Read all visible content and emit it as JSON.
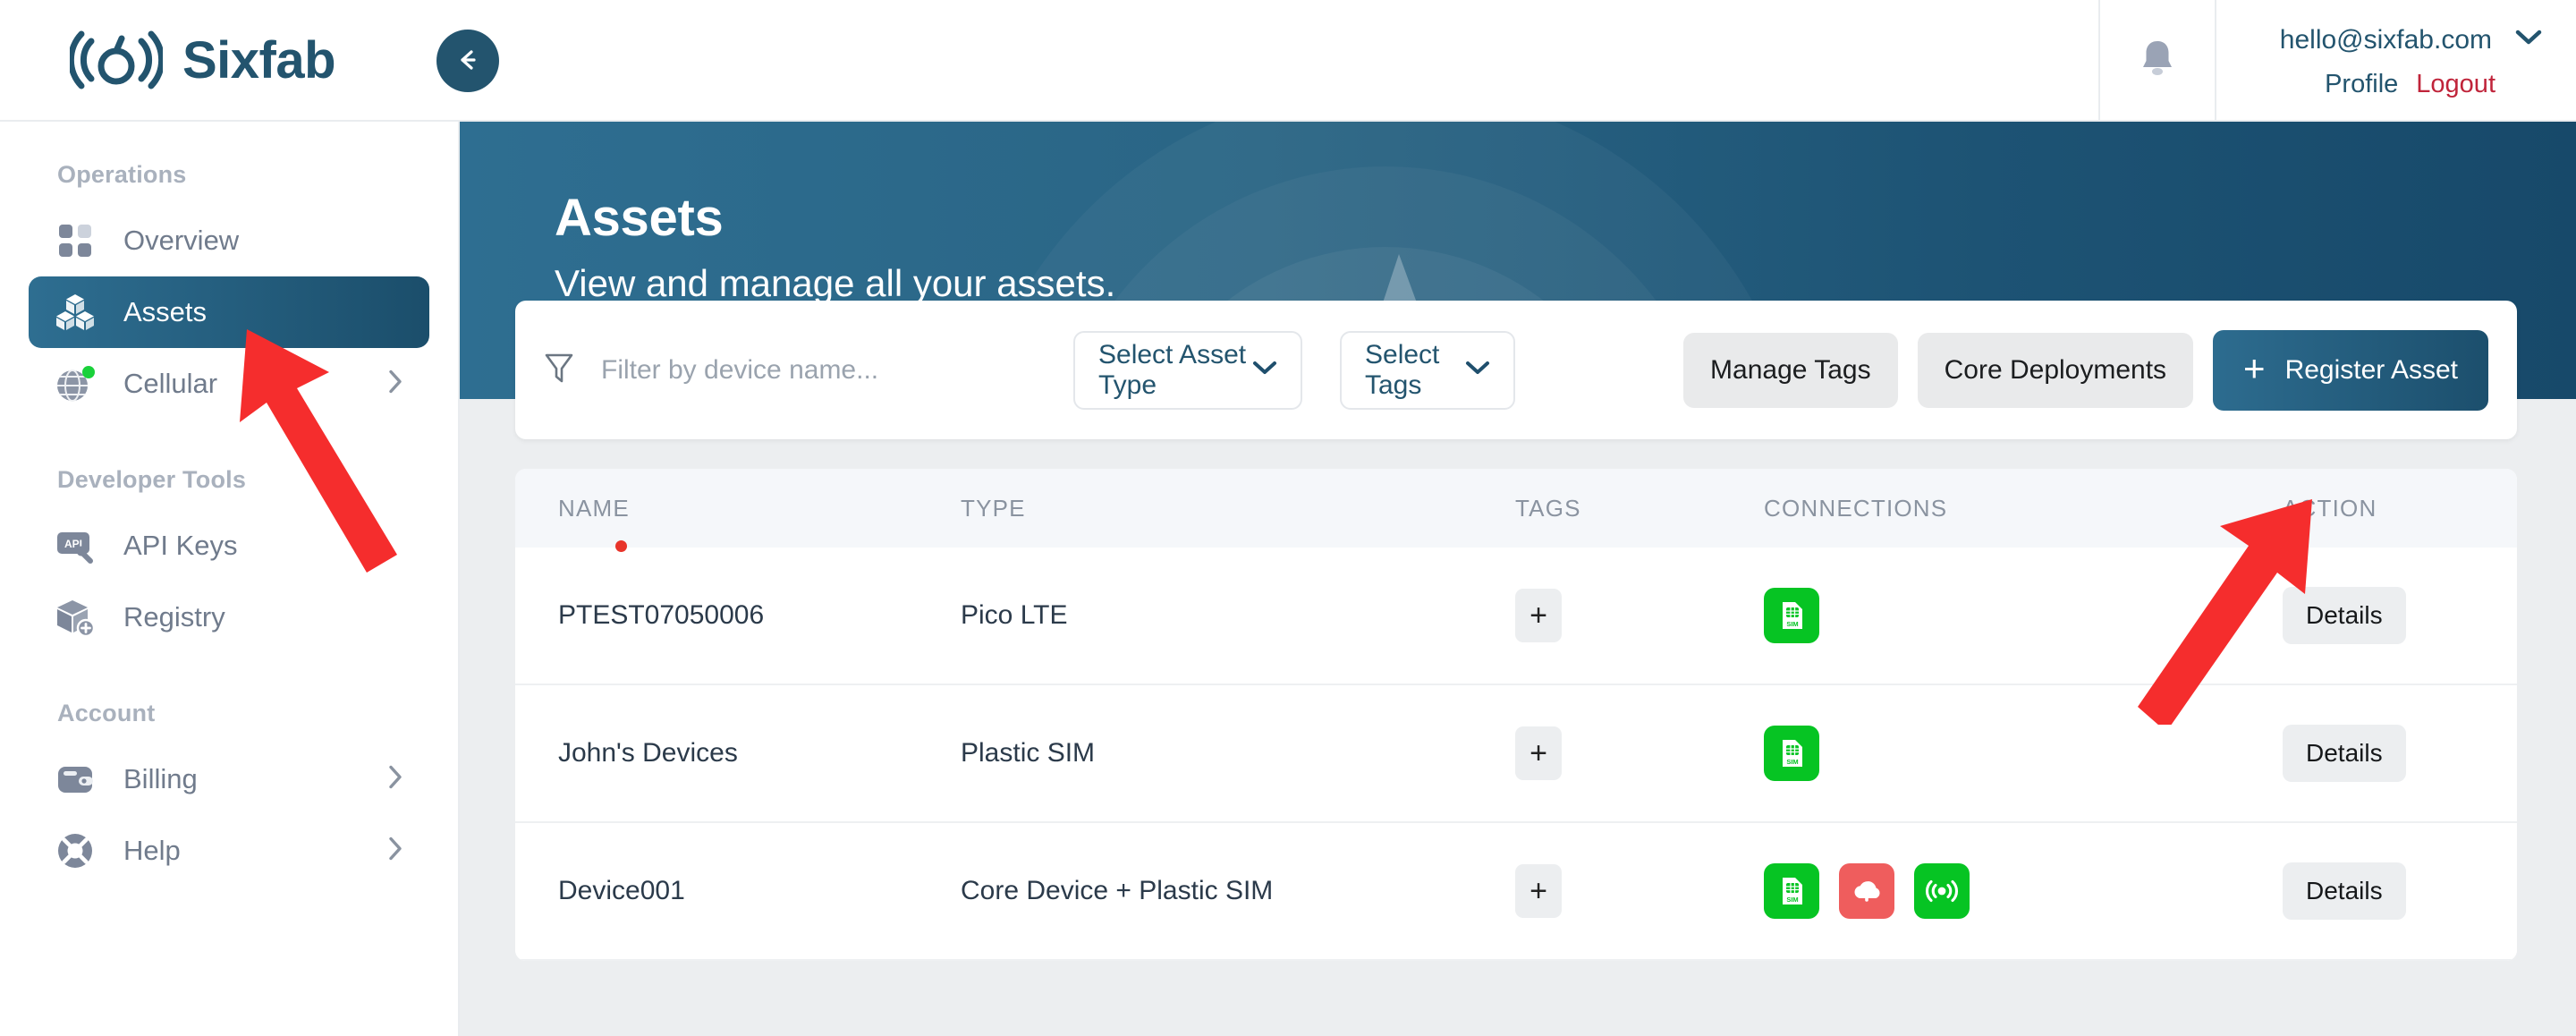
{
  "brand": {
    "name": "Sixfab",
    "logo_icon": "sixfab-logo-icon"
  },
  "topbar": {
    "collapse_icon": "arrow-left-icon",
    "bell_icon": "bell-icon",
    "chevron_icon": "chevron-down-icon",
    "user_email": "hello@sixfab.com",
    "profile_label": "Profile",
    "logout_label": "Logout"
  },
  "sidebar": {
    "groups": [
      {
        "title": "Operations",
        "items": [
          {
            "label": "Overview",
            "icon": "grid-icon",
            "active": false,
            "chevron": false
          },
          {
            "label": "Assets",
            "icon": "boxes-icon",
            "active": true,
            "chevron": false
          },
          {
            "label": "Cellular",
            "icon": "globe-icon",
            "active": false,
            "chevron": true,
            "badge": "online-dot"
          }
        ]
      },
      {
        "title": "Developer Tools",
        "items": [
          {
            "label": "API Keys",
            "icon": "api-wrench-icon",
            "active": false,
            "chevron": false
          },
          {
            "label": "Registry",
            "icon": "box-plus-icon",
            "active": false,
            "chevron": false
          }
        ]
      },
      {
        "title": "Account",
        "items": [
          {
            "label": "Billing",
            "icon": "wallet-icon",
            "active": false,
            "chevron": true
          },
          {
            "label": "Help",
            "icon": "lifebuoy-icon",
            "active": false,
            "chevron": true
          }
        ]
      }
    ]
  },
  "banner": {
    "title": "Assets",
    "subtitle": "View and manage all your assets."
  },
  "filter": {
    "filter_icon": "funnel-icon",
    "search_placeholder": "Filter by device name...",
    "search_value": "",
    "asset_type_label": "Select Asset Type",
    "tags_label": "Select Tags",
    "manage_tags_label": "Manage Tags",
    "core_deployments_label": "Core Deployments",
    "register_asset_label": "Register Asset",
    "register_asset_icon": "plus-icon"
  },
  "table": {
    "columns": [
      "NAME",
      "TYPE",
      "TAGS",
      "CONNECTIONS",
      "ACTION"
    ],
    "tag_add_label": "+",
    "details_label": "Details",
    "rows": [
      {
        "name": "PTEST07050006",
        "type": "Pico LTE",
        "tags": [],
        "connections": [
          {
            "icon": "sim-card-icon",
            "color": "#06c423"
          }
        ]
      },
      {
        "name": "John's Devices",
        "type": "Plastic SIM",
        "tags": [],
        "connections": [
          {
            "icon": "sim-card-icon",
            "color": "#06c423"
          }
        ]
      },
      {
        "name": "Device001",
        "type": "Core Device + Plastic SIM",
        "tags": [],
        "connections": [
          {
            "icon": "sim-card-icon",
            "color": "#06c423"
          },
          {
            "icon": "cloud-upload-icon",
            "color": "#ef5d5d"
          },
          {
            "icon": "broadcast-icon",
            "color": "#06c423"
          }
        ]
      }
    ]
  },
  "annotations": {
    "arrow_color": "#f52d2d",
    "arrows": [
      {
        "name": "arrow-to-assets-nav",
        "target": "Assets"
      },
      {
        "name": "arrow-to-register-asset",
        "target": "Register Asset"
      }
    ],
    "dot_color": "#e8342a"
  },
  "colors": {
    "brand_dark": "#23546e",
    "banner_left": "#2e6e91",
    "banner_right": "#17496a",
    "logout_red": "#c0243a",
    "green": "#06c423",
    "red": "#ef5d5d"
  }
}
